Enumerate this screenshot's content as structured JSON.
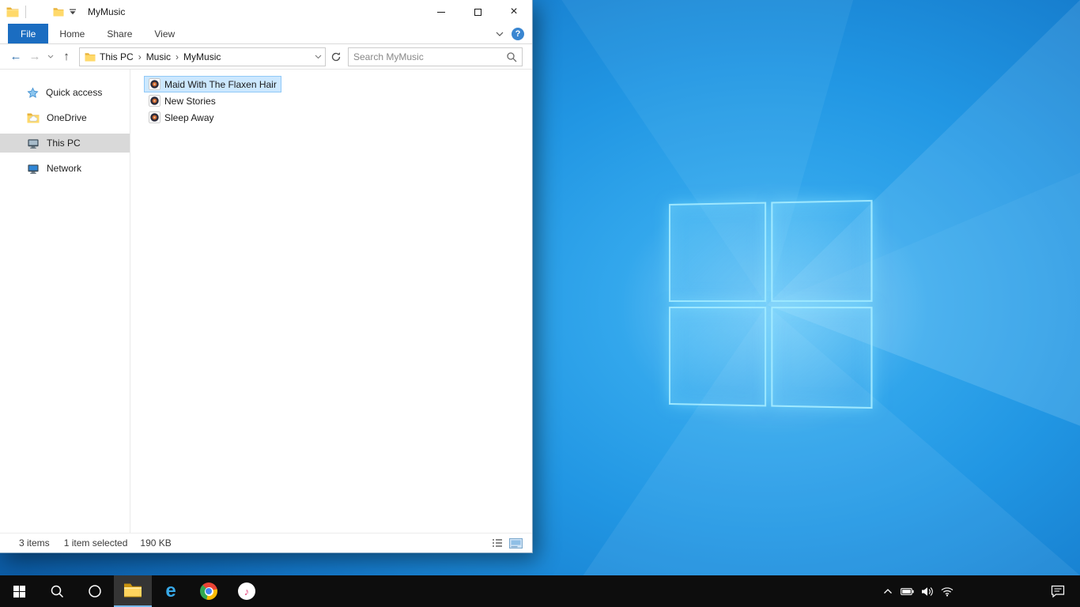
{
  "glyphs": {
    "close": "×",
    "back": "←",
    "forward": "→",
    "up": "↑",
    "help": "?",
    "ie": "e",
    "note": "♪",
    "crumb_separator": "›"
  },
  "colors": {
    "file_tab_blue": "#1b6dc1",
    "selection_fill": "#cce8ff",
    "selection_border": "#91c9f7",
    "nav_selected_gray": "#d9d9d9",
    "taskbar_black": "#0d0d0d",
    "folder_yellow": "#ffd96a",
    "taskbar_active_underline": "#76b9ed"
  },
  "window": {
    "title": "MyMusic",
    "ribbon": {
      "file_tab": "File",
      "tabs": [
        "Home",
        "Share",
        "View"
      ]
    },
    "address": {
      "breadcrumbs": [
        "This PC",
        "Music",
        "MyMusic"
      ],
      "search_placeholder": "Search MyMusic"
    },
    "nav_items": [
      {
        "label": "Quick access"
      },
      {
        "label": "OneDrive"
      },
      {
        "label": "This PC"
      },
      {
        "label": "Network"
      }
    ],
    "files": [
      {
        "name": "Maid With The Flaxen Hair"
      },
      {
        "name": "New Stories"
      },
      {
        "name": "Sleep Away"
      }
    ],
    "status": {
      "count": "3 items",
      "selected": "1 item selected",
      "size": "190 KB"
    }
  },
  "taskbar": {
    "buttons": [
      "start",
      "search",
      "cortana",
      "file-explorer",
      "internet-explorer",
      "chrome",
      "itunes"
    ],
    "tray": [
      "hidden-icons",
      "battery",
      "volume",
      "network",
      "action-center"
    ]
  }
}
